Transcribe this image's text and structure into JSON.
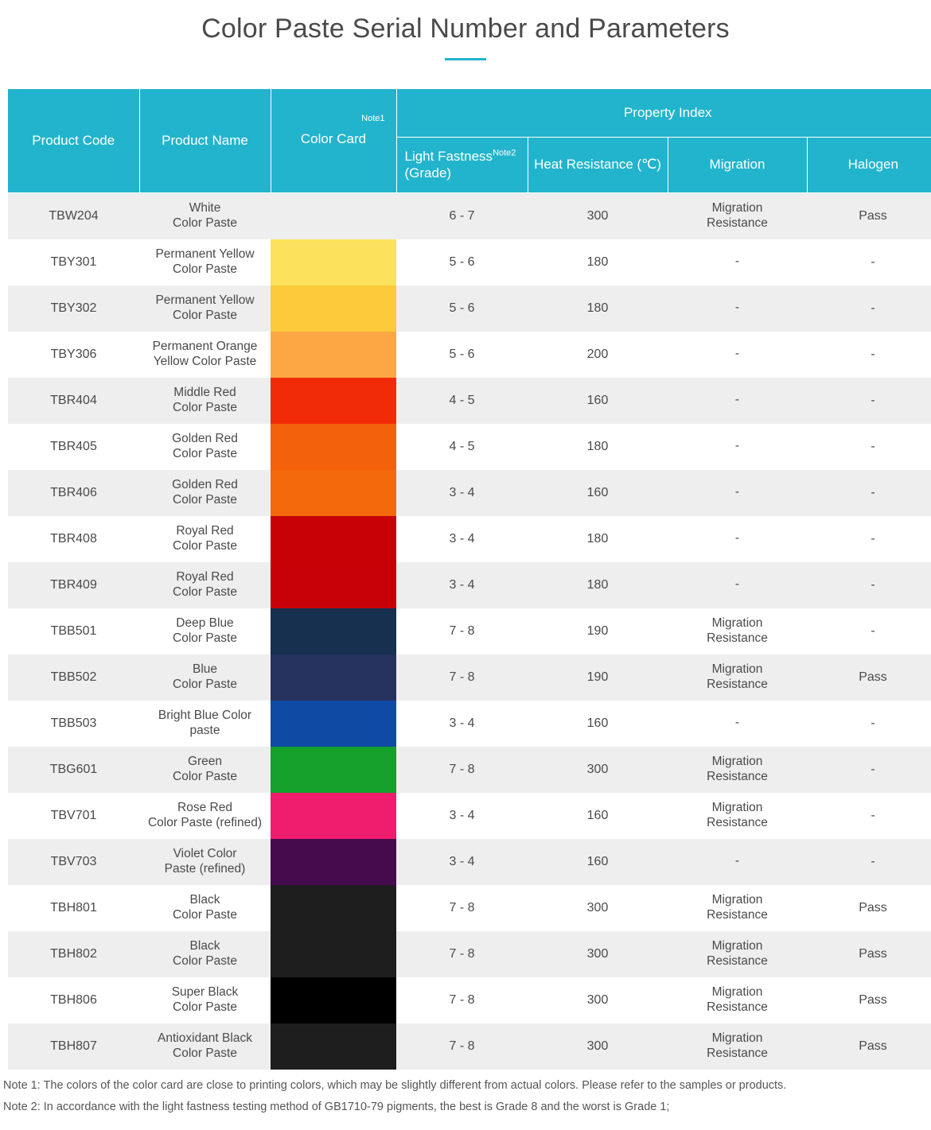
{
  "page": {
    "title": "Color Paste Serial Number and Parameters",
    "accent_color": "#22b4cc"
  },
  "table": {
    "headers": {
      "product_code": "Product Code",
      "product_name": "Product Name",
      "color_card": "Color Card",
      "color_card_note": "Note1",
      "property_index": "Property Index",
      "light_fastness": "Light Fastness",
      "light_fastness_note": "Note2",
      "light_fastness_unit": "(Grade)",
      "heat_resistance": "Heat Resistance (℃)",
      "migration": "Migration",
      "halogen": "Halogen"
    },
    "rows": [
      {
        "code": "TBW204",
        "name": "White Color Paste",
        "swatch": "",
        "light": "6 - 7",
        "heat": "300",
        "migration": "Migration Resistance",
        "halogen": "Pass"
      },
      {
        "code": "TBY301",
        "name": "Permanent Yellow Color Paste",
        "swatch": "#fce25c",
        "light": "5 - 6",
        "heat": "180",
        "migration": "-",
        "halogen": "-"
      },
      {
        "code": "TBY302",
        "name": "Permanent Yellow Color Paste",
        "swatch": "#fcca3a",
        "light": "5 - 6",
        "heat": "180",
        "migration": "-",
        "halogen": "-"
      },
      {
        "code": "TBY306",
        "name": "Permanent Orange Yellow Color Paste",
        "swatch": "#fca743",
        "light": "5 - 6",
        "heat": "200",
        "migration": "-",
        "halogen": "-"
      },
      {
        "code": "TBR404",
        "name": "Middle Red Color Paste",
        "swatch": "#f12b07",
        "light": "4 - 5",
        "heat": "160",
        "migration": "-",
        "halogen": "-"
      },
      {
        "code": "TBR405",
        "name": "Golden Red Color Paste",
        "swatch": "#f3610a",
        "light": "4 - 5",
        "heat": "180",
        "migration": "-",
        "halogen": "-"
      },
      {
        "code": "TBR406",
        "name": "Golden Red Color Paste",
        "swatch": "#f4690b",
        "light": "3 - 4",
        "heat": "160",
        "migration": "-",
        "halogen": "-"
      },
      {
        "code": "TBR408",
        "name": "Royal Red Color Paste",
        "swatch": "#c60004",
        "light": "3 - 4",
        "heat": "180",
        "migration": "-",
        "halogen": "-"
      },
      {
        "code": "TBR409",
        "name": "Royal Red Color Paste",
        "swatch": "#c70007",
        "light": "3 - 4",
        "heat": "180",
        "migration": "-",
        "halogen": "-"
      },
      {
        "code": "TBB501",
        "name": "Deep Blue Color Paste",
        "swatch": "#17304f",
        "light": "7 - 8",
        "heat": "190",
        "migration": "Migration Resistance",
        "halogen": "-"
      },
      {
        "code": "TBB502",
        "name": "Blue Color Paste",
        "swatch": "#26325e",
        "light": "7 - 8",
        "heat": "190",
        "migration": "Migration Resistance",
        "halogen": "Pass"
      },
      {
        "code": "TBB503",
        "name": "Bright Blue Color paste",
        "swatch": "#0f4ba4",
        "light": "3 - 4",
        "heat": "160",
        "migration": "-",
        "halogen": "-"
      },
      {
        "code": "TBG601",
        "name": "Green Color Paste",
        "swatch": "#14a02a",
        "light": "7 - 8",
        "heat": "300",
        "migration": "Migration Resistance",
        "halogen": "-"
      },
      {
        "code": "TBV701",
        "name": "Rose Red Color Paste (refined)",
        "swatch": "#f01c6d",
        "light": "3 - 4",
        "heat": "160",
        "migration": "Migration Resistance",
        "halogen": "-"
      },
      {
        "code": "TBV703",
        "name": "Violet Color Paste (refined)",
        "swatch": "#450b4c",
        "light": "3 - 4",
        "heat": "160",
        "migration": "-",
        "halogen": "-"
      },
      {
        "code": "TBH801",
        "name": "Black Color Paste",
        "swatch": "#1e1e1e",
        "light": "7 - 8",
        "heat": "300",
        "migration": "Migration Resistance",
        "halogen": "Pass"
      },
      {
        "code": "TBH802",
        "name": "Black Color Paste",
        "swatch": "#1e1e1e",
        "light": "7 - 8",
        "heat": "300",
        "migration": "Migration Resistance",
        "halogen": "Pass"
      },
      {
        "code": "TBH806",
        "name": "Super Black Color Paste",
        "swatch": "#000000",
        "light": "7 - 8",
        "heat": "300",
        "migration": "Migration Resistance",
        "halogen": "Pass"
      },
      {
        "code": "TBH807",
        "name": "Antioxidant Black Color Paste",
        "swatch": "#1e1e1e",
        "light": "7 - 8",
        "heat": "300",
        "migration": "Migration Resistance",
        "halogen": "Pass"
      }
    ]
  },
  "notes": [
    "Note 1: The colors of the color card are close to printing colors, which may be slightly different from actual colors. Please refer to the samples or products.",
    "Note 2: In accordance with the light fastness testing method of GB1710-79 pigments, the best is Grade 8 and the worst is Grade 1;"
  ]
}
